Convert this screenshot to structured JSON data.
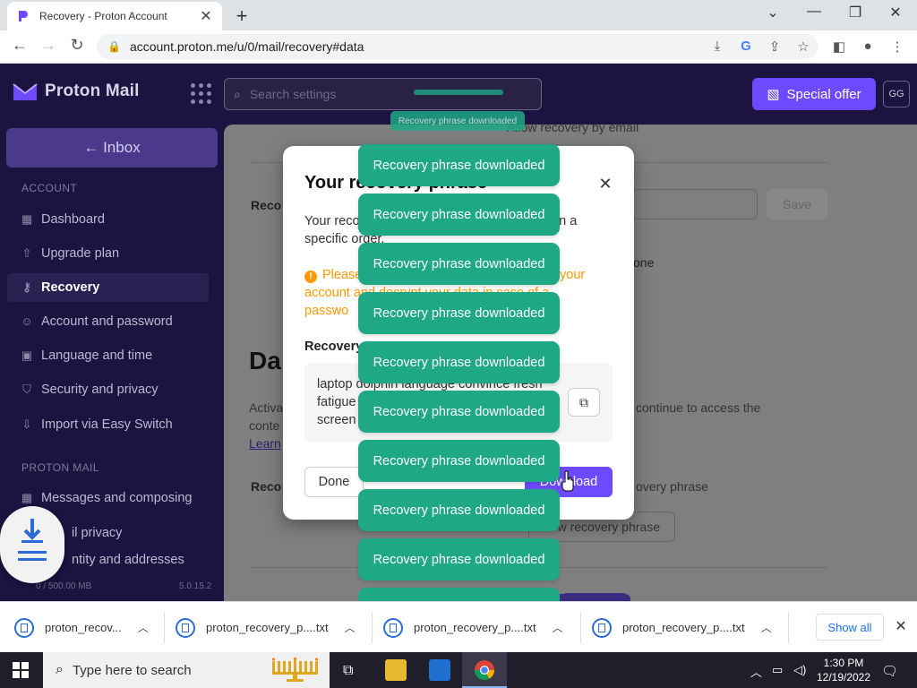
{
  "browser": {
    "tab_title": "Recovery - Proton Account",
    "new_tab": "+",
    "url": "account.proton.me/u/0/mail/recovery#data"
  },
  "app": {
    "brand": "Proton Mail",
    "search_placeholder": "Search settings",
    "special_offer": "Special offer",
    "avatar_initials": "GG",
    "inbox_label": "← Inbox",
    "account_heading": "ACCOUNT",
    "account_items": [
      {
        "label": "Dashboard",
        "icon": "dashboard-icon"
      },
      {
        "label": "Upgrade plan",
        "icon": "upgrade-icon"
      },
      {
        "label": "Recovery",
        "icon": "key-icon"
      },
      {
        "label": "Account and password",
        "icon": "user-icon"
      },
      {
        "label": "Language and time",
        "icon": "language-icon"
      },
      {
        "label": "Security and privacy",
        "icon": "shield-icon"
      },
      {
        "label": "Import via Easy Switch",
        "icon": "import-icon"
      }
    ],
    "mail_heading": "PROTON MAIL",
    "mail_items": [
      {
        "label": "Messages and composing",
        "icon": "grid-icon"
      },
      {
        "label": "il privacy",
        "icon": "privacy-icon"
      },
      {
        "label": "ntity and addresses",
        "icon": "identity-icon"
      }
    ],
    "storage": "0 / 500.00 MB",
    "version": "5.0.15.2"
  },
  "background": {
    "allow_email": "Allow recovery by email",
    "reco_label": "Reco",
    "save_button": "Save",
    "none_text": "one",
    "data_heading": "Da",
    "activa_text": "Activa",
    "conte_text": "conte",
    "learn_text": "Learn",
    "continue_text": "continue to access the",
    "reco_label2": "Reco",
    "phrase_text": "overy phrase",
    "view_phrase": "w recovery phrase"
  },
  "modal": {
    "title": "Your recovery phrase",
    "desc_left": "Your reco",
    "desc_right": "s in a",
    "desc_line2": "specific order.",
    "warn_left": "Please",
    "warn_right": "ess your",
    "warn_line2": "account and decrypt your data in case of a",
    "warn_line3": "passwo",
    "phrase_label": "Recovery",
    "phrase_line1": "laptop dolphin language convince fresh",
    "phrase_line2": "fatigue",
    "phrase_line3": "screen",
    "done_button": "Done",
    "download_button": "Download"
  },
  "toasts": {
    "small": "Recovery phrase downloaded",
    "items": [
      "Recovery phrase downloaded",
      "Recovery phrase downloaded",
      "Recovery phrase downloaded",
      "Recovery phrase downloaded",
      "Recovery phrase downloaded",
      "Recovery phrase downloaded",
      "Recovery phrase downloaded",
      "Recovery phrase downloaded",
      "Recovery phrase downloaded"
    ]
  },
  "downloads": {
    "files": [
      "proton_recov...",
      "proton_recovery_p....txt",
      "proton_recovery_p....txt",
      "proton_recovery_p....txt"
    ],
    "show_all": "Show all"
  },
  "taskbar": {
    "search_placeholder": "Type here to search",
    "time": "1:30 PM",
    "date": "12/19/2022"
  },
  "colors": {
    "accent": "#6d4aff",
    "toast": "#1ea885",
    "sidebar": "#1b1340",
    "warning": "#ff9900"
  }
}
